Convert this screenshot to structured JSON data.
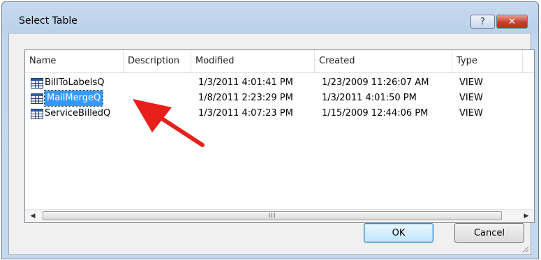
{
  "window": {
    "title": "Select Table",
    "help_label": "?",
    "close_label": "✕"
  },
  "table": {
    "columns": [
      "Name",
      "Description",
      "Modified",
      "Created",
      "Type"
    ],
    "rows": [
      {
        "name": "BillToLabelsQ",
        "description": "",
        "modified": "1/3/2011 4:01:41 PM",
        "created": "1/23/2009 11:26:07 AM",
        "type": "VIEW",
        "selected": false
      },
      {
        "name": "MailMergeQ",
        "description": "",
        "modified": "1/8/2011 2:23:29 PM",
        "created": "1/3/2011 4:01:50 PM",
        "type": "VIEW",
        "selected": true
      },
      {
        "name": "ServiceBilledQ",
        "description": "",
        "modified": "1/3/2011 4:07:23 PM",
        "created": "1/15/2009 12:44:06 PM",
        "type": "VIEW",
        "selected": false
      }
    ]
  },
  "scrollbar": {
    "left_arrow": "◀",
    "right_arrow": "▶",
    "grip": "III"
  },
  "buttons": {
    "ok_label": "OK",
    "cancel_label": "Cancel"
  },
  "annotation": {
    "arrow_color": "#e8201c"
  },
  "colors": {
    "selection": "#3399ff",
    "title_bar": "#c3d7ee"
  }
}
